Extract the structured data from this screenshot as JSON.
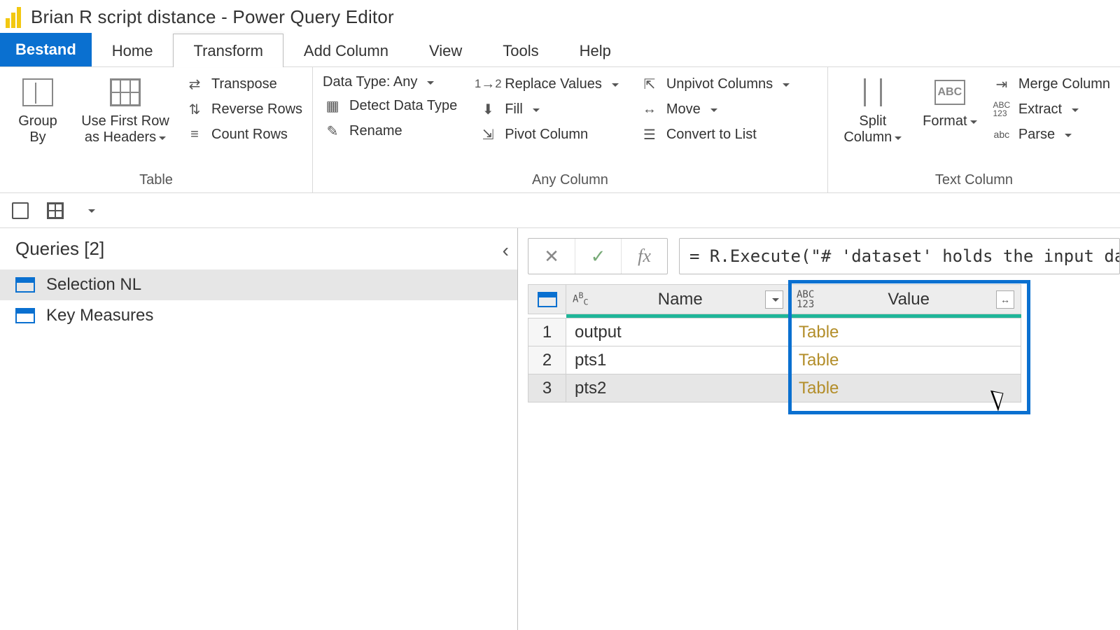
{
  "window": {
    "title": "Brian R script distance - Power Query Editor"
  },
  "menu": {
    "file": "Bestand",
    "tabs": [
      "Home",
      "Transform",
      "Add Column",
      "View",
      "Tools",
      "Help"
    ],
    "active": "Transform"
  },
  "ribbon": {
    "tableGroup": {
      "label": "Table",
      "groupBy": "Group\nBy",
      "useFirstRow": "Use First Row\nas Headers",
      "transpose": "Transpose",
      "reverseRows": "Reverse Rows",
      "countRows": "Count Rows"
    },
    "anyColGroup": {
      "label": "Any Column",
      "dataType": "Data Type: Any",
      "detect": "Detect Data Type",
      "rename": "Rename",
      "replace": "Replace Values",
      "fill": "Fill",
      "pivot": "Pivot Column",
      "unpivot": "Unpivot Columns",
      "move": "Move",
      "convert": "Convert to List"
    },
    "textColGroup": {
      "label": "Text Column",
      "split": "Split\nColumn",
      "format": "Format",
      "merge": "Merge Column",
      "extract": "Extract",
      "parse": "Parse"
    }
  },
  "qat": {
    "save": "save",
    "grid": "show-whitespace",
    "more": "more"
  },
  "queries": {
    "title": "Queries [2]",
    "items": [
      {
        "name": "Selection NL",
        "selected": true
      },
      {
        "name": "Key Measures",
        "selected": false
      }
    ]
  },
  "formula": {
    "cancel": "✕",
    "commit": "✓",
    "fx": "fx",
    "text": "= R.Execute(\"# 'dataset' holds the input dat"
  },
  "grid": {
    "cornerIcon": "table-icon",
    "columns": [
      {
        "key": "name",
        "header": "Name",
        "typeIcon": "ABC",
        "filter": "dropdown"
      },
      {
        "key": "value",
        "header": "Value",
        "typeIcon": "ABC123",
        "filter": "expand"
      }
    ],
    "rows": [
      {
        "n": "1",
        "name": "output",
        "value": "Table"
      },
      {
        "n": "2",
        "name": "pts1",
        "value": "Table"
      },
      {
        "n": "3",
        "name": "pts2",
        "value": "Table",
        "selected": true
      }
    ]
  }
}
